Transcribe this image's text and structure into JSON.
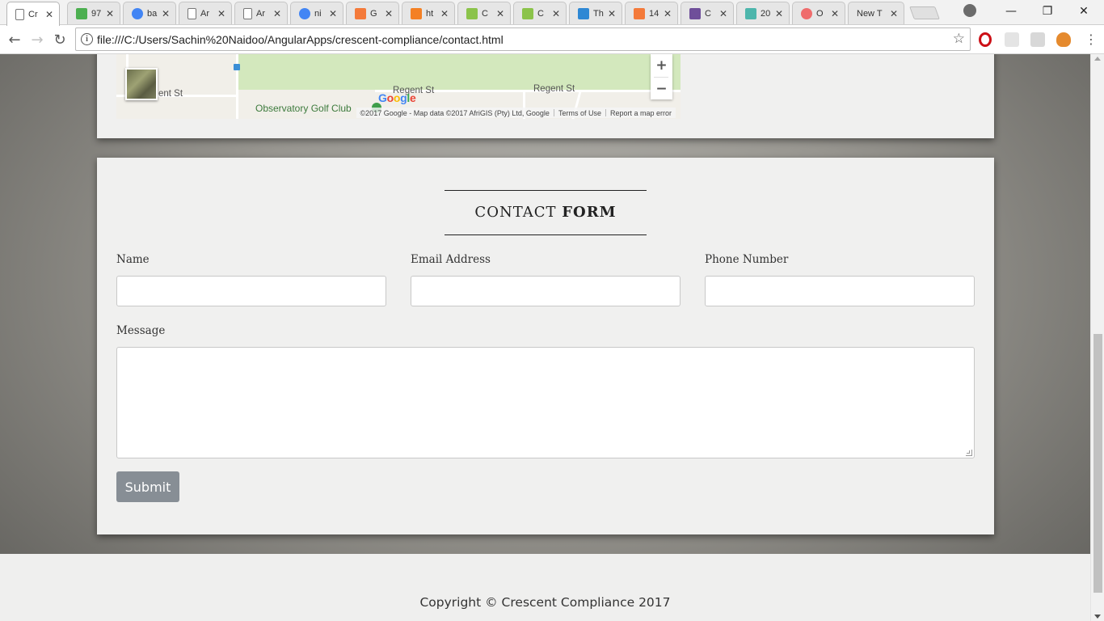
{
  "browser": {
    "tabs": [
      {
        "title": "Cr",
        "icon": "page-icon",
        "color": "#ffffff"
      },
      {
        "title": "97",
        "icon": "google-maps-icon",
        "color": "#4caf50"
      },
      {
        "title": "ba",
        "icon": "google-icon",
        "color": "#4285f4"
      },
      {
        "title": "Ar",
        "icon": "page-icon",
        "color": "#ffffff"
      },
      {
        "title": "Ar",
        "icon": "page-icon",
        "color": "#ffffff"
      },
      {
        "title": "ni",
        "icon": "google-icon",
        "color": "#4285f4"
      },
      {
        "title": "G",
        "icon": "codepen-html-icon",
        "color": "#f47a3a"
      },
      {
        "title": "ht",
        "icon": "stackoverflow-icon",
        "color": "#f48024"
      },
      {
        "title": "C",
        "icon": "w3schools-icon",
        "color": "#8bc34a"
      },
      {
        "title": "C",
        "icon": "w3schools-icon",
        "color": "#8bc34a"
      },
      {
        "title": "Th",
        "icon": "sitepoint-icon",
        "color": "#2e88d4"
      },
      {
        "title": "14",
        "icon": "codepen-html-icon",
        "color": "#f47a3a"
      },
      {
        "title": "C",
        "icon": "bootstrap-icon",
        "color": "#6f4f9a"
      },
      {
        "title": "20",
        "icon": "teal-square-icon",
        "color": "#4db6ac"
      },
      {
        "title": "O",
        "icon": "red-circle-icon",
        "color": "#ef6c6c"
      },
      {
        "title": "New T",
        "icon": "none",
        "color": ""
      }
    ],
    "url": "file:///C:/Users/Sachin%20Naidoo/AngularApps/crescent-compliance/contact.html",
    "window_controls": {
      "minimize": "—",
      "restore": "❐",
      "close": "✕"
    }
  },
  "map": {
    "labels": {
      "street_left": "ent St",
      "street_mid": "Regent St",
      "street_right": "Regent St",
      "golf": "Observatory Golf Club"
    },
    "zoom_in": "+",
    "zoom_out": "−",
    "google_logo": "Google",
    "attribution": "©2017 Google - Map data ©2017 AfriGIS (Pty) Ltd, Google",
    "terms": "Terms of Use",
    "report": "Report a map error"
  },
  "contact_form": {
    "heading_light": "CONTACT",
    "heading_bold": "FORM",
    "name_label": "Name",
    "email_label": "Email Address",
    "phone_label": "Phone Number",
    "message_label": "Message",
    "name_value": "",
    "email_value": "",
    "phone_value": "",
    "message_value": "",
    "submit_label": "Submit"
  },
  "footer": {
    "copyright": "Copyright © Crescent Compliance 2017"
  },
  "colors": {
    "submit_bg": "#878e95",
    "card_bg": "#f0f0ef",
    "park_green": "#d3e8bd"
  }
}
